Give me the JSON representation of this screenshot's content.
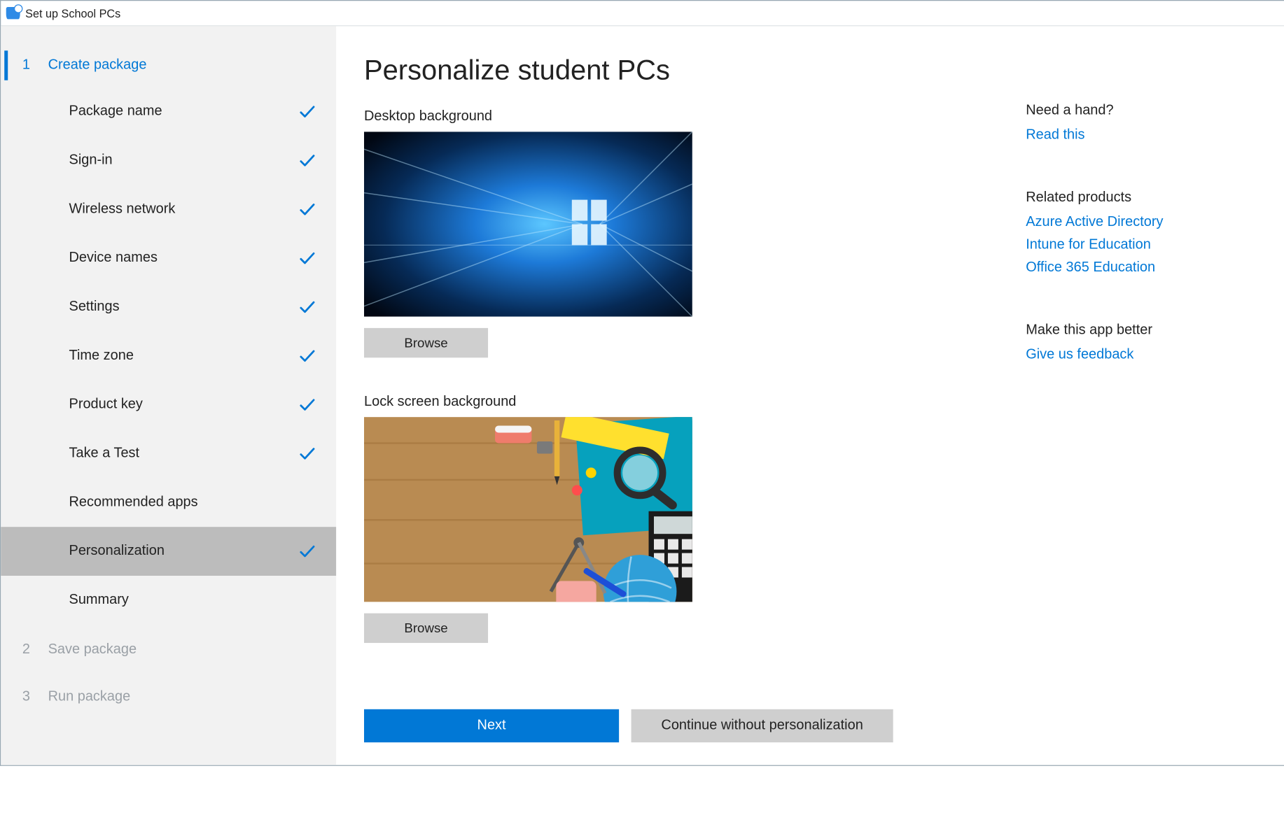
{
  "app": {
    "title": "Set up School PCs"
  },
  "sidebar": {
    "step1": {
      "num": "1",
      "label": "Create package"
    },
    "step2": {
      "num": "2",
      "label": "Save package"
    },
    "step3": {
      "num": "3",
      "label": "Run package"
    },
    "substeps": [
      {
        "label": "Package name",
        "checked": true,
        "selected": false
      },
      {
        "label": "Sign-in",
        "checked": true,
        "selected": false
      },
      {
        "label": "Wireless network",
        "checked": true,
        "selected": false
      },
      {
        "label": "Device names",
        "checked": true,
        "selected": false
      },
      {
        "label": "Settings",
        "checked": true,
        "selected": false
      },
      {
        "label": "Time zone",
        "checked": true,
        "selected": false
      },
      {
        "label": "Product key",
        "checked": true,
        "selected": false
      },
      {
        "label": "Take a Test",
        "checked": true,
        "selected": false
      },
      {
        "label": "Recommended apps",
        "checked": false,
        "selected": false
      },
      {
        "label": "Personalization",
        "checked": true,
        "selected": true
      },
      {
        "label": "Summary",
        "checked": false,
        "selected": false
      }
    ]
  },
  "main": {
    "page_title": "Personalize student PCs",
    "desktop_section": "Desktop background",
    "lock_section": "Lock screen background",
    "browse_label": "Browse",
    "next_label": "Next",
    "continue_label": "Continue without personalization"
  },
  "side": {
    "help_heading": "Need a hand?",
    "help_link": "Read this",
    "related_heading": "Related products",
    "related_links": [
      "Azure Active Directory",
      "Intune for Education",
      "Office 365 Education"
    ],
    "feedback_heading": "Make this app better",
    "feedback_link": "Give us feedback"
  }
}
